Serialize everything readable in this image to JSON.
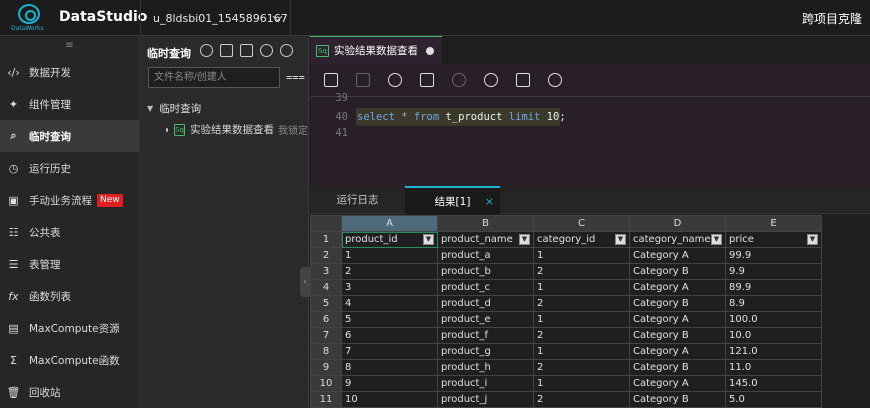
{
  "header": {
    "app_name": "DataStudio",
    "logo_sub": "DataWorks",
    "workspace": "u_8ldsbi01_1545896167",
    "cross_project": "跨项目克隆"
  },
  "sidebar": {
    "menu_icon": "≡",
    "items": [
      {
        "label": "数据开发",
        "icon": "code-icon"
      },
      {
        "label": "组件管理",
        "icon": "puzzle-icon"
      },
      {
        "label": "临时查询",
        "icon": "search-icon"
      },
      {
        "label": "运行历史",
        "icon": "clock-icon"
      },
      {
        "label": "手动业务流程",
        "icon": "workflow-icon",
        "badge": "New"
      },
      {
        "label": "公共表",
        "icon": "table-icon"
      },
      {
        "label": "表管理",
        "icon": "table-manage-icon"
      },
      {
        "label": "函数列表",
        "icon": "function-icon"
      },
      {
        "label": "MaxCompute资源",
        "icon": "resource-icon"
      },
      {
        "label": "MaxCompute函数",
        "icon": "sigma-icon"
      },
      {
        "label": "回收站",
        "icon": "trash-icon"
      }
    ]
  },
  "panel": {
    "title": "临时查询",
    "search_placeholder": "文件名称/创建人",
    "folder": "临时查询",
    "file_icon": "Sq",
    "file": "实验结果数据查看",
    "locked": "我锁定"
  },
  "editor": {
    "tab_label": "实验结果数据查看",
    "tab_icon": "Sq",
    "lines": [
      {
        "no": "39"
      },
      {
        "no": "40"
      },
      {
        "no": "41"
      }
    ],
    "code": {
      "kw1": "select",
      "star": " * ",
      "kw2": "from",
      "table": " t_product ",
      "kw3": "limit",
      "num": " 10;"
    }
  },
  "results": {
    "tabs": [
      "运行日志",
      "结果[1]"
    ],
    "close": "×",
    "col_letters": [
      "A",
      "B",
      "C",
      "D",
      "E"
    ],
    "headers": [
      "product_id",
      "product_name",
      "category_id",
      "category_name",
      "price"
    ],
    "rows": [
      [
        "1",
        "product_a",
        "1",
        "Category A",
        "99.9"
      ],
      [
        "2",
        "product_b",
        "2",
        "Category B",
        "9.9"
      ],
      [
        "3",
        "product_c",
        "1",
        "Category A",
        "89.9"
      ],
      [
        "4",
        "product_d",
        "2",
        "Category B",
        "8.9"
      ],
      [
        "5",
        "product_e",
        "1",
        "Category A",
        "100.0"
      ],
      [
        "6",
        "product_f",
        "2",
        "Category B",
        "10.0"
      ],
      [
        "7",
        "product_g",
        "1",
        "Category A",
        "121.0"
      ],
      [
        "8",
        "product_h",
        "2",
        "Category B",
        "11.0"
      ],
      [
        "9",
        "product_i",
        "1",
        "Category A",
        "145.0"
      ],
      [
        "10",
        "product_j",
        "2",
        "Category B",
        "5.0"
      ]
    ],
    "row_numbers": [
      "1",
      "2",
      "3",
      "4",
      "5",
      "6",
      "7",
      "8",
      "9",
      "10",
      "11"
    ]
  }
}
